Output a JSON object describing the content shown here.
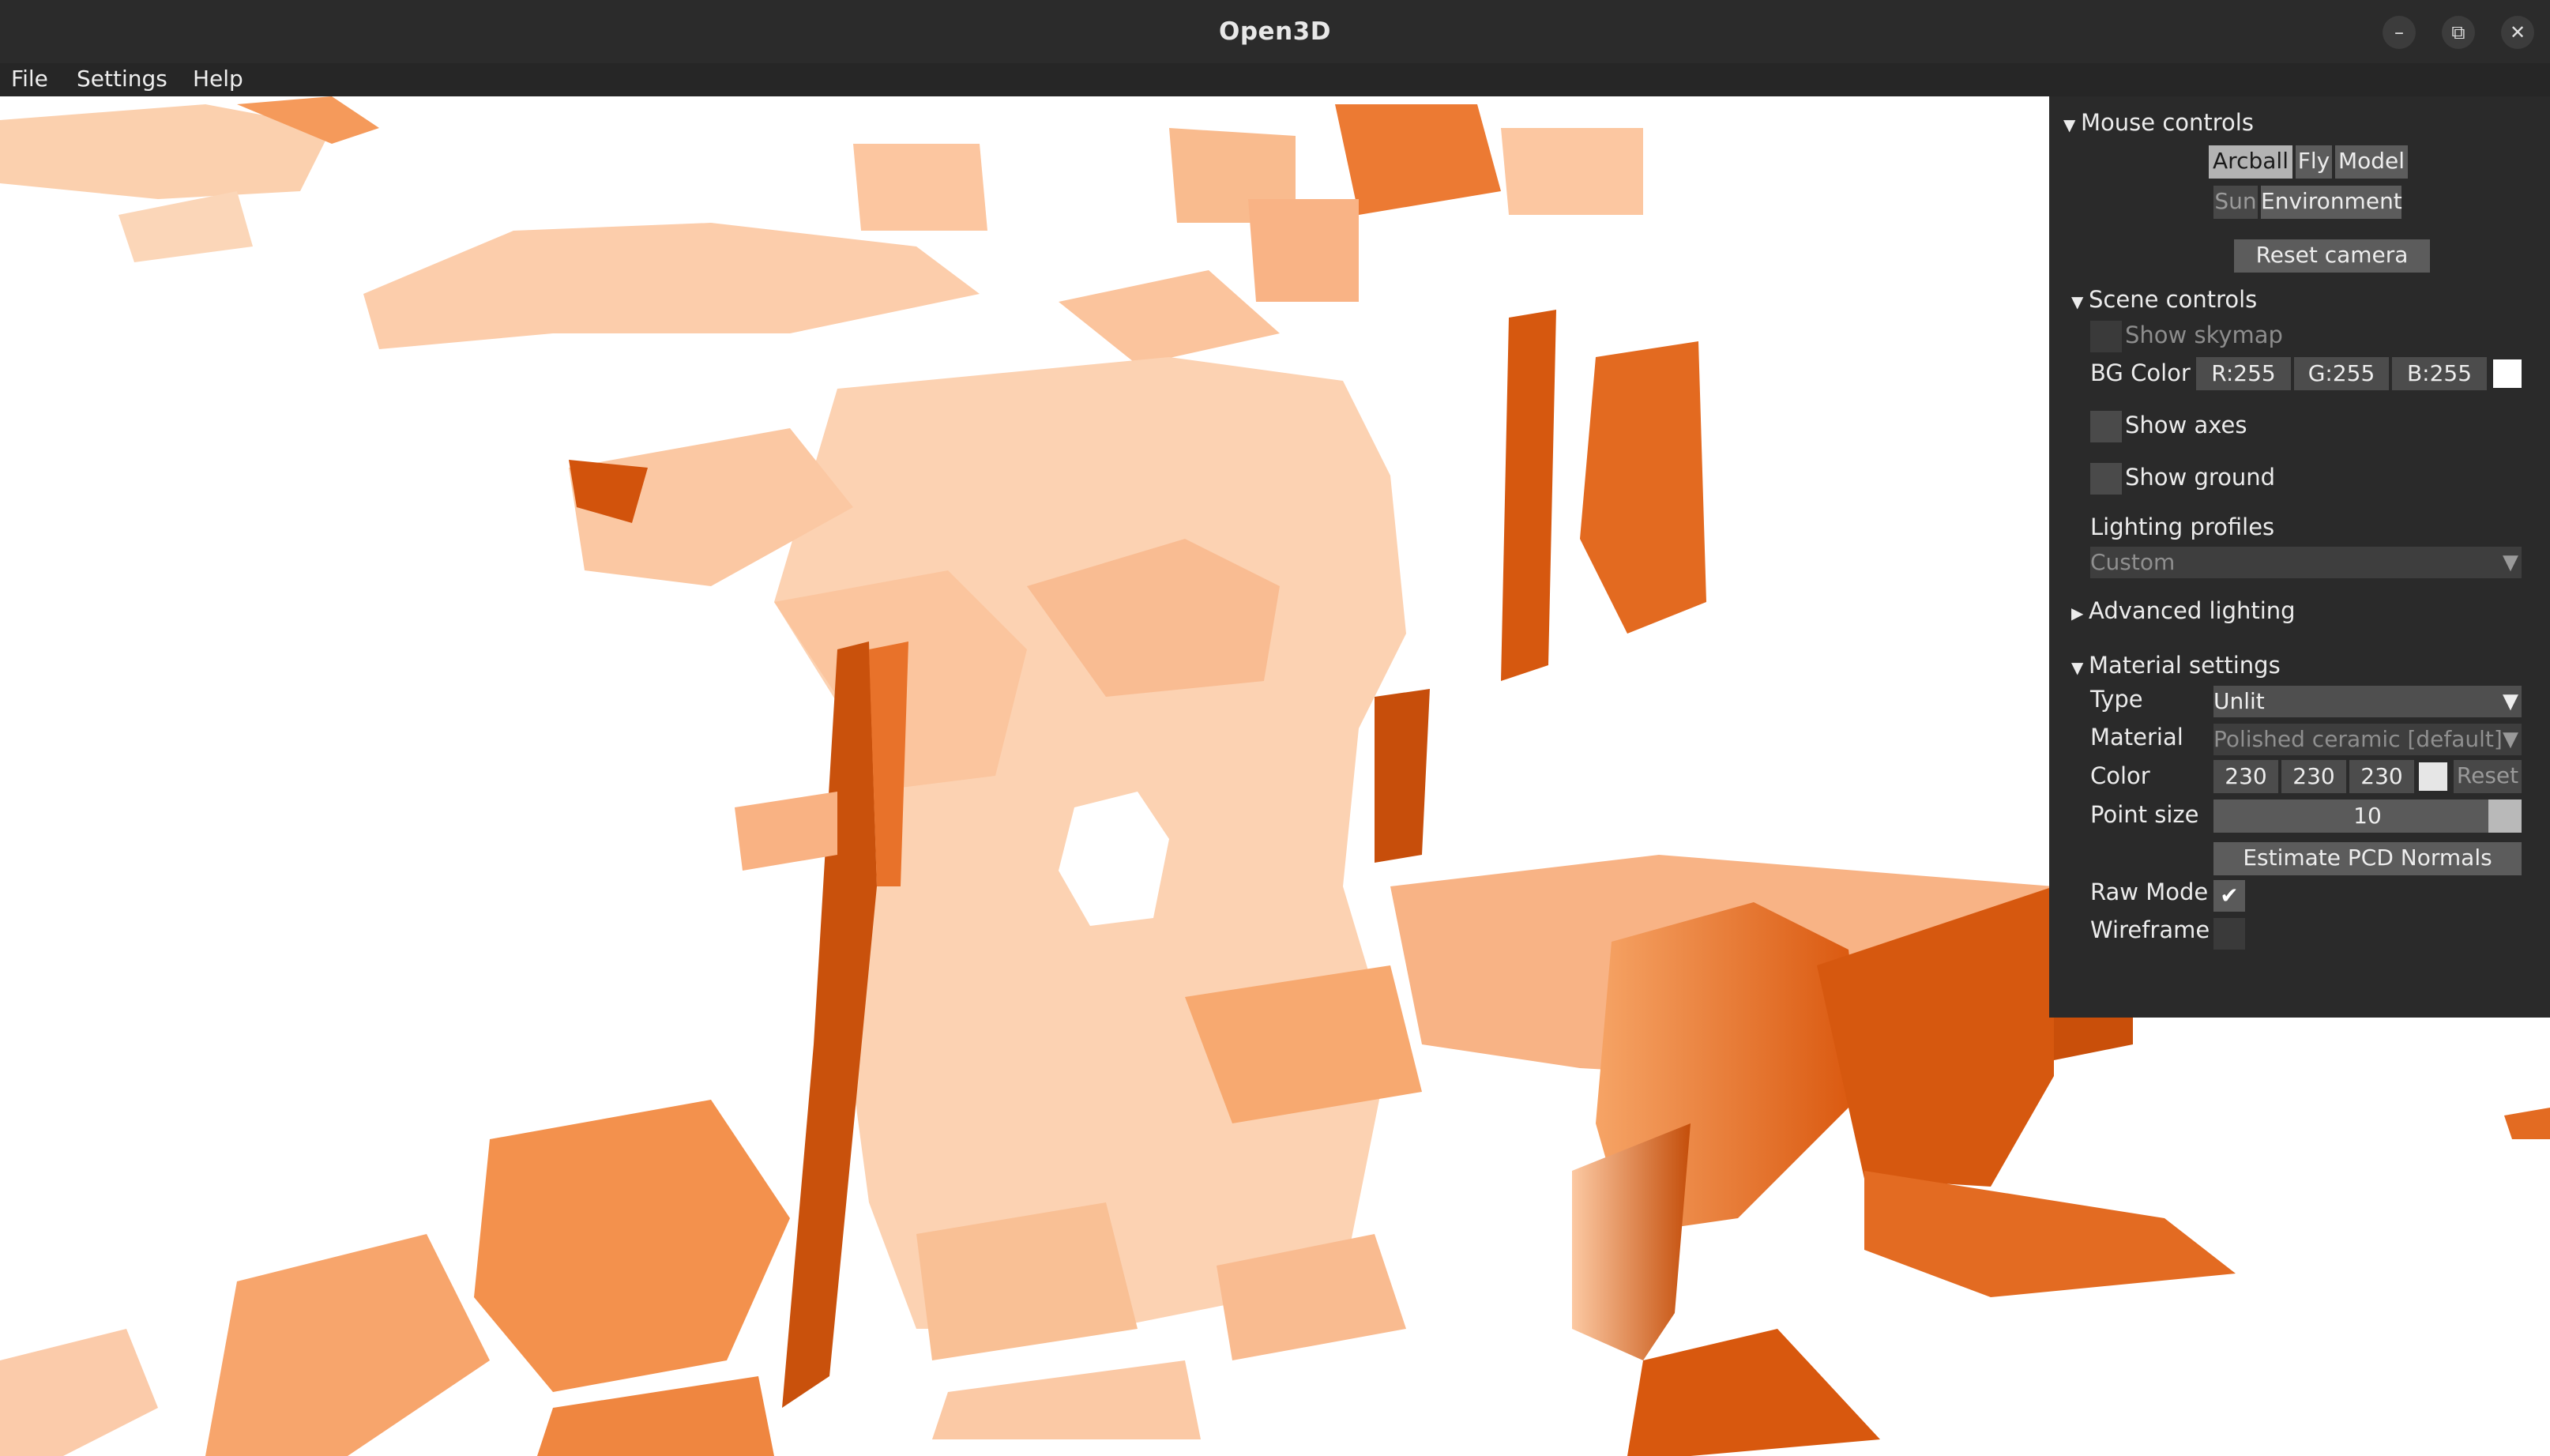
{
  "window": {
    "title": "Open3D",
    "minimize_glyph": "–",
    "maximize_glyph": "⧉",
    "close_glyph": "✕"
  },
  "menu": {
    "items": [
      "File",
      "Settings",
      "Help"
    ]
  },
  "viewport": {
    "description_colors": {
      "light": "#fbd3b3",
      "mid": "#f5a063",
      "dark": "#d85a10"
    }
  },
  "panel": {
    "mouse_controls": {
      "header": "Mouse controls",
      "buttons": {
        "arcball": "Arcball",
        "fly": "Fly",
        "model": "Model",
        "sun": "Sun",
        "environment": "Environment"
      },
      "active": "Arcball",
      "reset_camera": "Reset camera"
    },
    "scene_controls": {
      "header": "Scene controls",
      "show_skymap": {
        "label": "Show skymap",
        "checked": false
      },
      "bg_color": {
        "label": "BG Color",
        "r": "R:255",
        "g": "G:255",
        "b": "B:255",
        "swatch": "#ffffff"
      },
      "show_axes": {
        "label": "Show axes",
        "checked": false
      },
      "show_ground": {
        "label": "Show ground",
        "checked": false
      },
      "lighting_profiles": {
        "label": "Lighting profiles",
        "value": "Custom"
      }
    },
    "advanced_lighting": {
      "header": "Advanced lighting"
    },
    "material_settings": {
      "header": "Material settings",
      "type": {
        "label": "Type",
        "value": "Unlit"
      },
      "material": {
        "label": "Material",
        "value": "Polished ceramic [default]"
      },
      "color": {
        "label": "Color",
        "r": "230",
        "g": "230",
        "b": "230",
        "swatch": "#e6e6e6",
        "reset": "Reset"
      },
      "point_size": {
        "label": "Point size",
        "value": "10"
      },
      "estimate_normals": "Estimate PCD Normals",
      "raw_mode": {
        "label": "Raw Mode",
        "checked": true
      },
      "wireframe": {
        "label": "Wireframe",
        "checked": false
      }
    },
    "glyphs": {
      "expanded": "▼",
      "collapsed": "▶",
      "dropdown": "▼",
      "check": "✔"
    }
  }
}
